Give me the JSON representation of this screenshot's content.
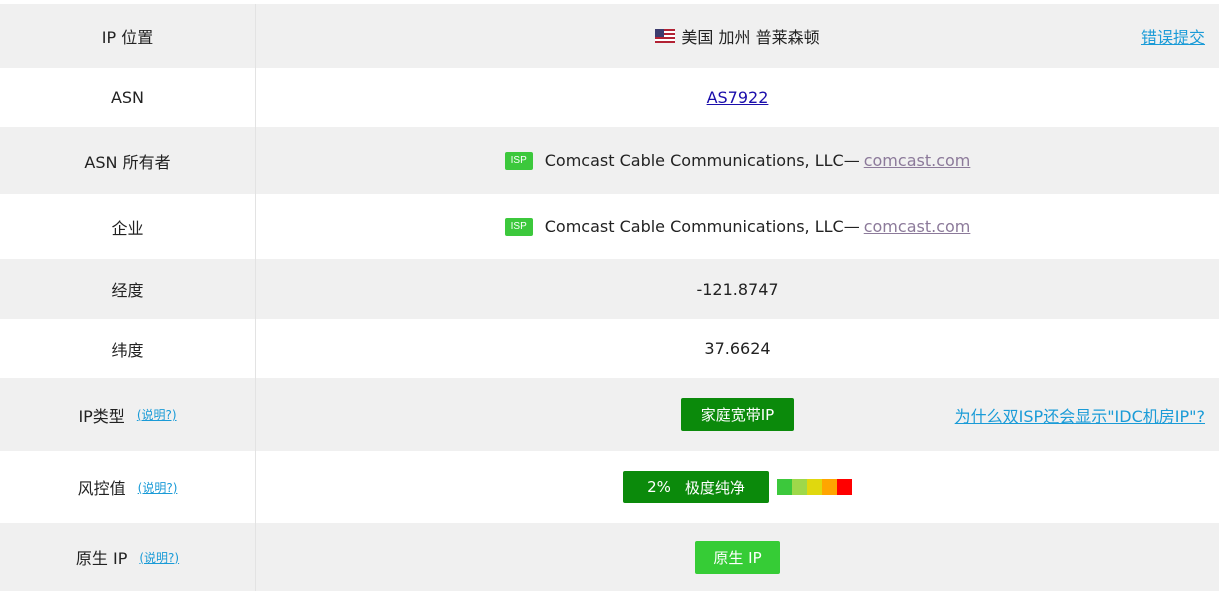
{
  "rows": {
    "ip_location": {
      "label": "IP 位置",
      "value": "美国 加州 普莱森顿",
      "flag_icon": "us-flag-icon",
      "report_link": "错误提交"
    },
    "asn": {
      "label": "ASN",
      "value": "AS7922"
    },
    "asn_owner": {
      "label": "ASN 所有者",
      "badge": "ISP",
      "name": "Comcast Cable Communications, LLC—",
      "domain": "comcast.com"
    },
    "company": {
      "label": "企业",
      "badge": "ISP",
      "name": "Comcast Cable Communications, LLC—",
      "domain": "comcast.com"
    },
    "longitude": {
      "label": "经度",
      "value": "-121.8747"
    },
    "latitude": {
      "label": "纬度",
      "value": "37.6624"
    },
    "ip_type": {
      "label": "IP类型",
      "help": "(说明?)",
      "value": "家庭宽带IP",
      "faq_link": "为什么双ISP还会显示\"IDC机房IP\"?"
    },
    "risk": {
      "label": "风控值",
      "help": "(说明?)",
      "percent": "2%",
      "level": "极度纯净",
      "scale_colors": [
        "#3cc83c",
        "#9ed84a",
        "#e0d80e",
        "#ffa500",
        "#ff0000"
      ]
    },
    "native_ip": {
      "label": "原生 IP",
      "help": "(说明?)",
      "value": "原生 IP"
    }
  },
  "colors": {
    "badge_green": "#3cc83c",
    "button_dark_green": "#0b8a0b",
    "button_light_green": "#36cc36",
    "link_blue": "#1a9bd7",
    "row_gray": "#f0f0f0"
  }
}
